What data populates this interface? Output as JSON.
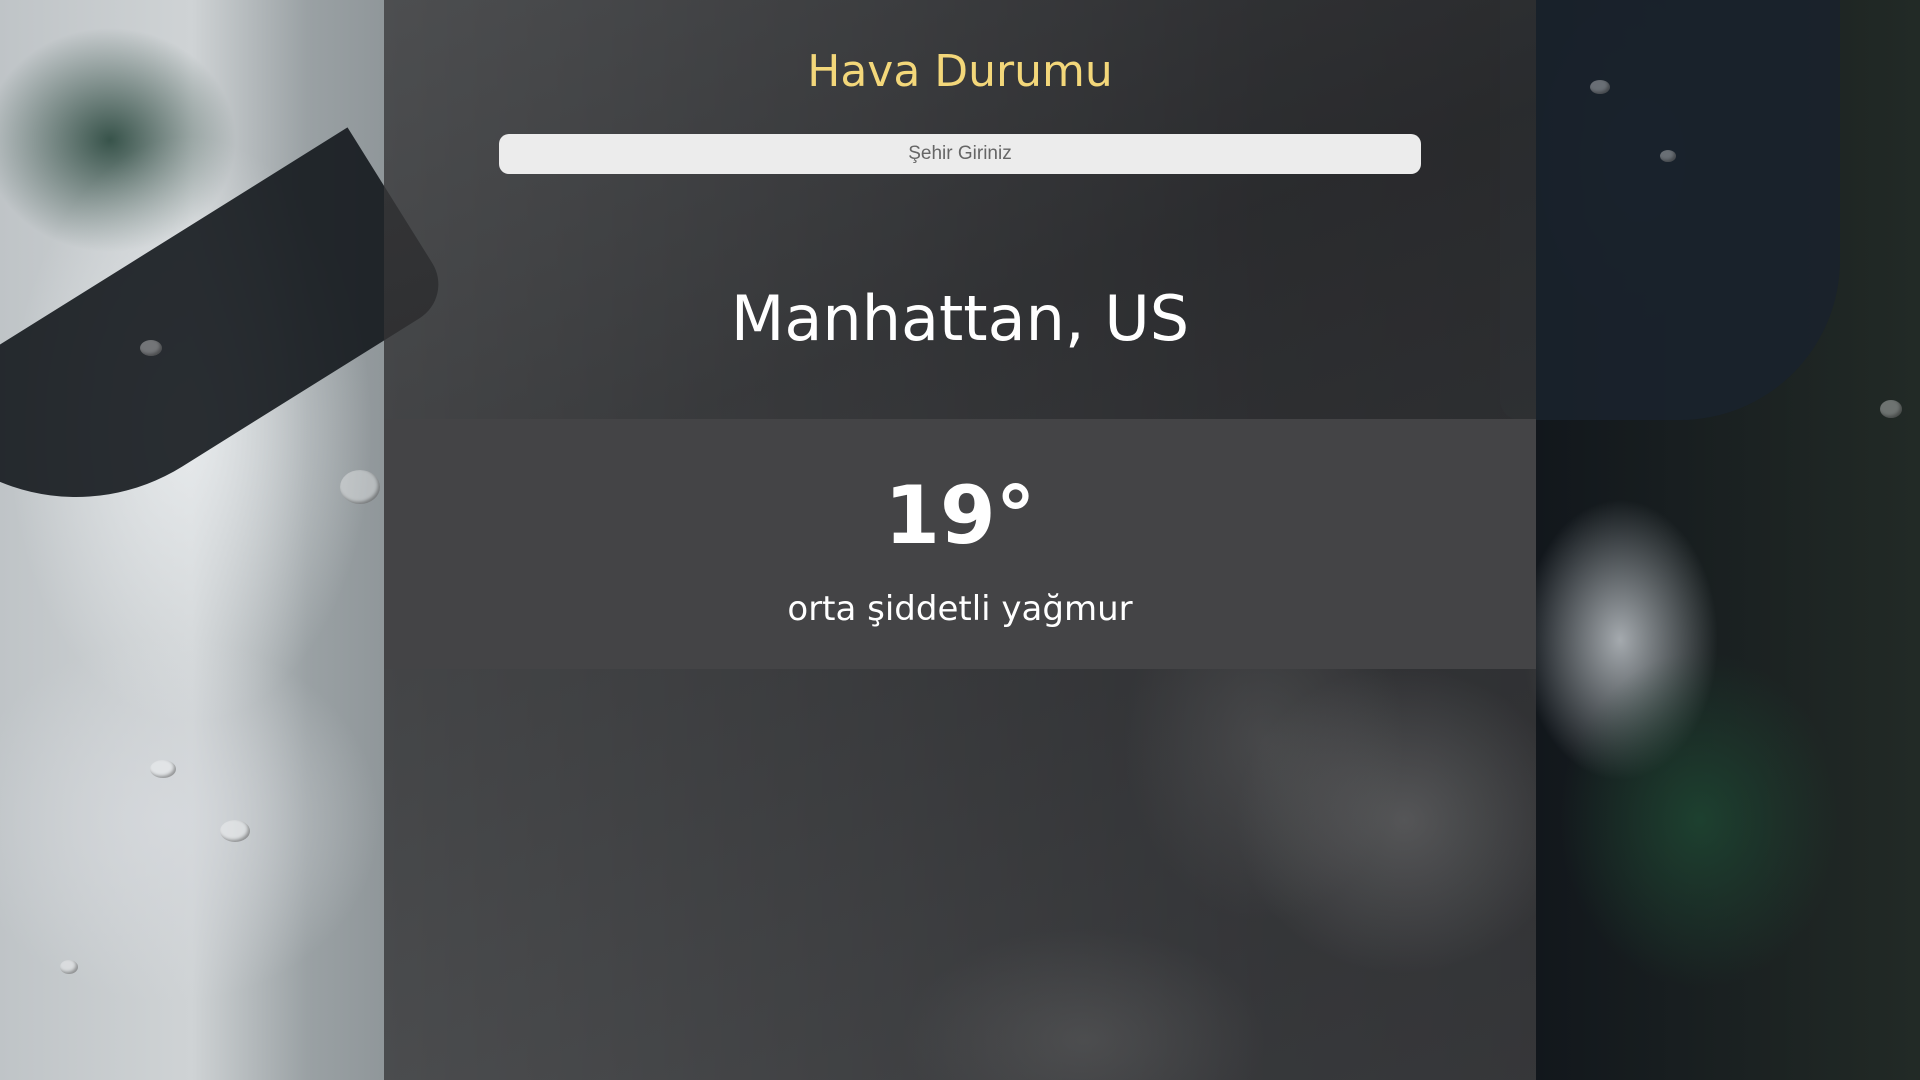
{
  "app": {
    "title": "Hava Durumu",
    "title_color": "#f3d77a"
  },
  "search": {
    "placeholder": "Şehir Giriniz",
    "value": ""
  },
  "weather": {
    "location": "Manhattan, US",
    "temperature": "19°",
    "description": "orta şiddetli yağmur"
  },
  "background": {
    "theme": "rainy umbrella photo"
  }
}
